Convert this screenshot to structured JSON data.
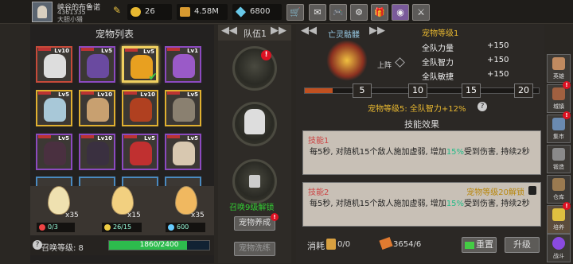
{
  "player": {
    "name": "峡谷的布鲁诺",
    "id_line1": "4361335",
    "id_line2": "大胆小猎"
  },
  "resources": {
    "gold": "26",
    "coins": "4.58M",
    "gems": "6800"
  },
  "pet_list": {
    "title": "宠物列表",
    "levels": [
      "Lv10",
      "Lv5",
      "Lv5",
      "Lv1",
      "Lv5",
      "Lv10",
      "Lv10",
      "Lv5",
      "Lv5",
      "Lv10",
      "Lv5",
      "Lv5"
    ]
  },
  "eggs": [
    {
      "count": "x35",
      "progress": "0/3"
    },
    {
      "count": "x15",
      "progress": "26/15"
    },
    {
      "count": "x35",
      "progress": "600"
    }
  ],
  "summon": {
    "label": "召唤等级: 8",
    "progress_text": "1860/2400",
    "progress_fraction": 0.775
  },
  "team": {
    "title": "队伍1",
    "unlock_text": "召唤9级解锁",
    "btn_nurture": "宠物养成",
    "btn_evolve": "宠物洗练"
  },
  "pet_detail": {
    "name": "亡灵骷髅",
    "pet_level": "宠物等级1",
    "equip_label": "上阵",
    "stats": [
      {
        "name": "全队力量",
        "value": "+150"
      },
      {
        "name": "全队智力",
        "value": "+150"
      },
      {
        "name": "全队敏捷",
        "value": "+150"
      }
    ],
    "milestones": [
      "5",
      "10",
      "15",
      "20"
    ],
    "progress_fraction": 0.05,
    "bonus_text": "宠物等级5: 全队智力+12%",
    "skills_title": "技能效果",
    "skill1": {
      "title": "技能1",
      "desc_a": "每5秒, 对随机15个敌人施加虚弱, 增加",
      "desc_pct": "15%",
      "desc_b": "受到伤害, 持续2秒"
    },
    "skill2": {
      "title": "技能2",
      "lock_text": "宠物等级20解锁",
      "desc_a": "每5秒, 对随机15个敌人施加虚弱, 增加",
      "desc_pct": "15%",
      "desc_b": "受到伤害, 持续2秒"
    },
    "consume_label": "消耗",
    "consume_a": "0/0",
    "consume_b": "3654/6",
    "btn_reset": "重置",
    "btn_upgrade": "升级"
  },
  "sidebar": [
    {
      "label": "英雄"
    },
    {
      "label": "城镇"
    },
    {
      "label": "集市"
    },
    {
      "label": "锻造"
    },
    {
      "label": "仓库"
    },
    {
      "label": "培养"
    },
    {
      "label": "战斗"
    }
  ],
  "colors": {
    "accent_gold": "#e8b830",
    "progress_green": "#2dbb4d",
    "slot_red": "#c64a3a",
    "slot_gold": "#e0b030",
    "slot_purple": "#8c4ac0",
    "slot_blue": "#4a8ac0"
  }
}
